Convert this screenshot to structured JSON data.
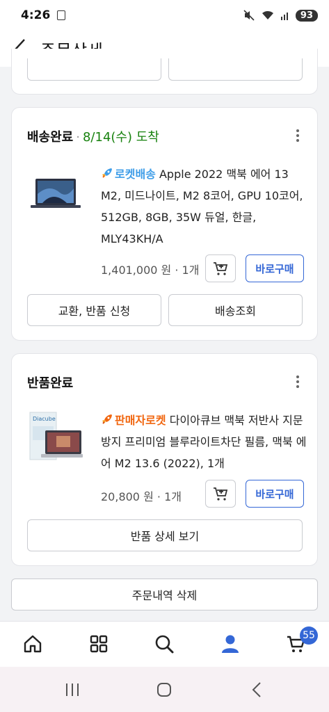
{
  "status_bar": {
    "time": "4:26",
    "battery": "93"
  },
  "header": {
    "title": "주문상세"
  },
  "orders": [
    {
      "status": "배송완료",
      "eta": "8/14(수) 도착",
      "badge": "로켓배송",
      "badge_color": "#3e9de8",
      "product_name": "Apple 2022 맥북 에어 13 M2, 미드나이트, M2 8코어, GPU 10코어, 512GB, 8GB, 35W 듀얼, 한글, MLY43KH/A",
      "price": "1,401,000 원",
      "quantity": "1개",
      "buy_label": "바로구매",
      "actions": [
        "교환, 반품 신청",
        "배송조회"
      ]
    },
    {
      "status": "반품완료",
      "badge": "판매자로켓",
      "badge_color": "#f1660f",
      "product_name": "다이아큐브 맥북 저반사 지문방지 프리미엄 블루라이트차단 필름, 맥북 에어 M2 13.6 (2022), 1개",
      "thumb_brand": "Diacube",
      "price": "20,800 원",
      "quantity": "1개",
      "buy_label": "바로구매",
      "detail_label": "반품 상세 보기"
    }
  ],
  "delete_label": "주문내역 삭제",
  "bottom_nav": {
    "items": [
      "home-icon",
      "category-grid-icon",
      "search-icon",
      "my-page-icon",
      "cart-icon"
    ],
    "cart_count": "55"
  },
  "colors": {
    "accent": "#3467d6",
    "eta_green": "#18820f"
  }
}
